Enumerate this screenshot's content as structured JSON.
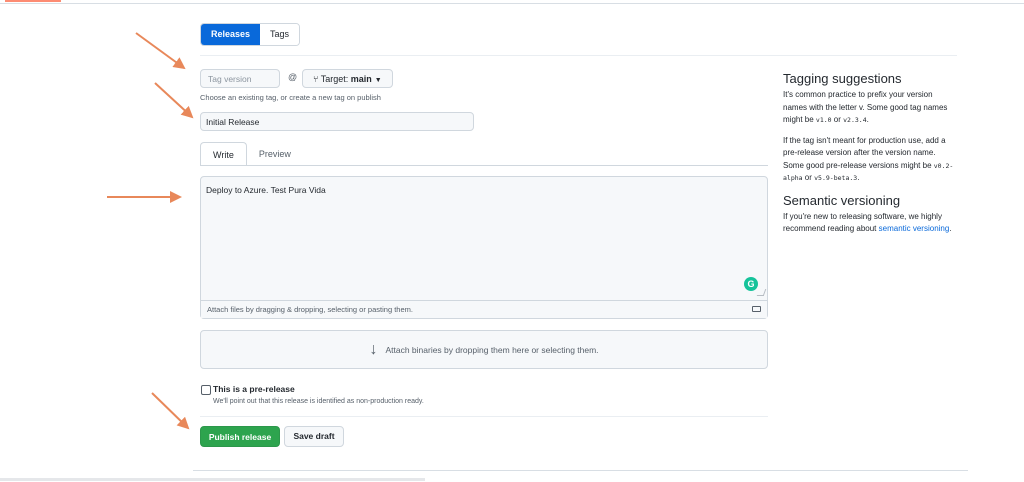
{
  "tabs": {
    "releases": "Releases",
    "tags": "Tags"
  },
  "tag": {
    "placeholder": "Tag version",
    "at_symbol": "@",
    "target_label": "Target:",
    "target_branch": "main",
    "hint": "Choose an existing tag, or create a new tag on publish"
  },
  "release_title": {
    "value": "Initial Release"
  },
  "editor": {
    "tab_write": "Write",
    "tab_preview": "Preview",
    "body": "Deploy to Azure. Test Pura Vida",
    "attach_hint": "Attach files by dragging & dropping, selecting or pasting them.",
    "grammarly_letter": "G"
  },
  "binaries": {
    "label": "Attach binaries by dropping them here or selecting them."
  },
  "prerelease": {
    "label": "This is a pre-release",
    "sub": "We'll point out that this release is identified as non-production ready."
  },
  "actions": {
    "publish": "Publish release",
    "save_draft": "Save draft"
  },
  "side": {
    "tag_heading": "Tagging suggestions",
    "tag_p1_a": "It's common practice to prefix your version names with the letter ",
    "tag_p1_v": "v",
    "tag_p1_b": ". Some good tag names might be ",
    "tag_p1_c1": "v1.0",
    "tag_p1_or": " or ",
    "tag_p1_c2": "v2.3.4",
    "tag_p1_end": ".",
    "tag_p2_a": "If the tag isn't meant for production use, add a pre-release version after the version name. Some good pre-release versions might be ",
    "tag_p2_c1": "v0.2-alpha",
    "tag_p2_or": " or ",
    "tag_p2_c2": "v5.9-beta.3",
    "tag_p2_end": ".",
    "sem_heading": "Semantic versioning",
    "sem_p_a": "If you're new to releasing software, we highly recommend reading about ",
    "sem_link": "semantic versioning",
    "sem_p_end": "."
  },
  "colors": {
    "accent": "#0969da",
    "publish": "#2da44e",
    "annotation": "#e8885a"
  }
}
